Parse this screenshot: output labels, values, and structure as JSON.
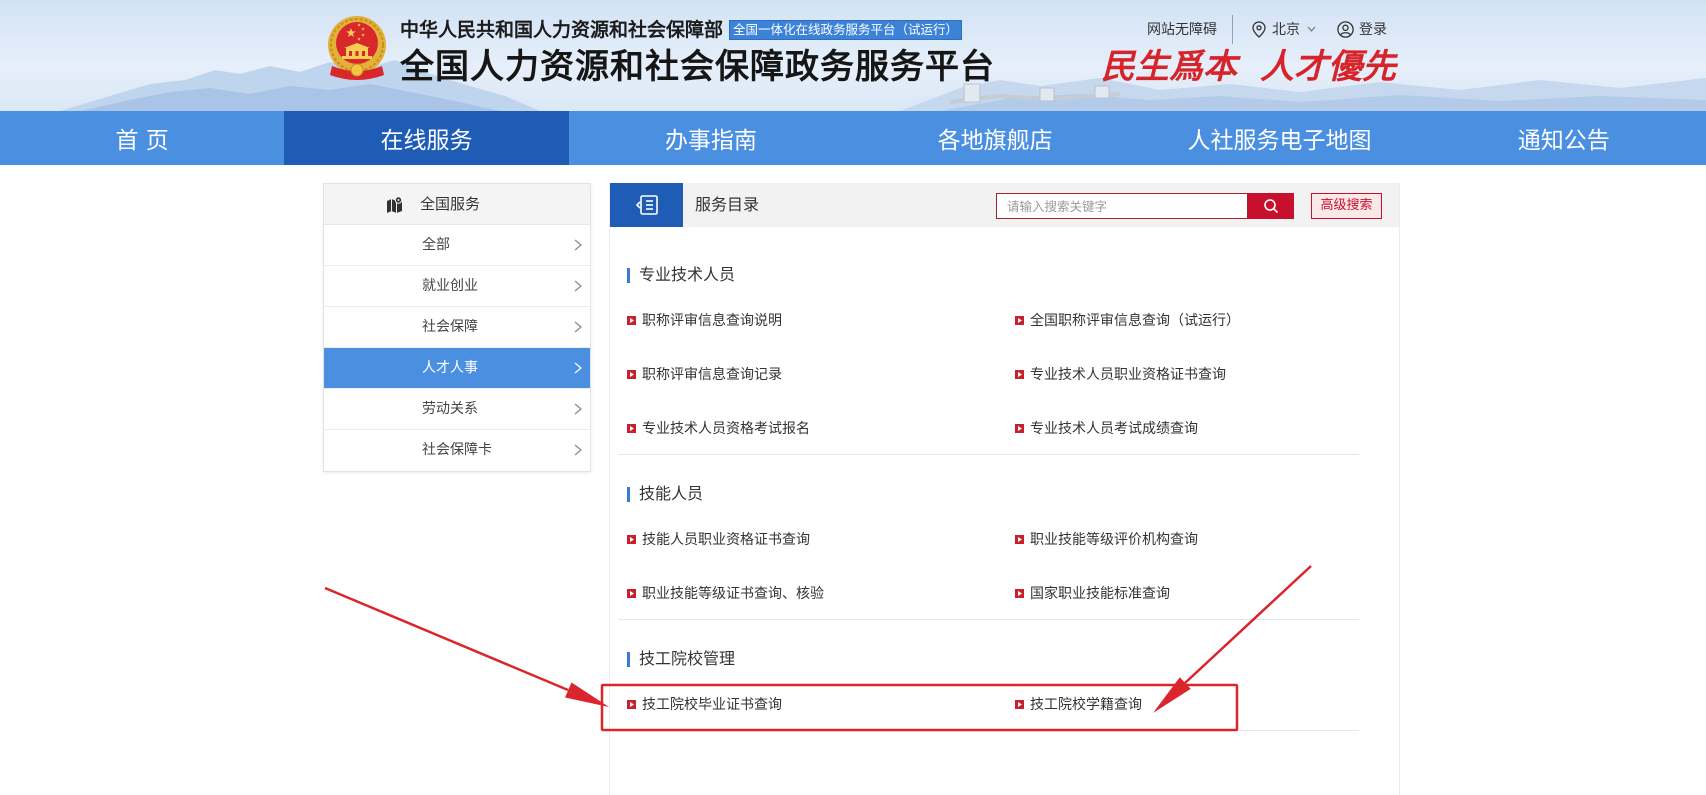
{
  "header": {
    "ministry": "中华人民共和国人力资源和社会保障部",
    "platform_badge": "全国一体化在线政务服务平台（试运行）",
    "title": "全国人力资源和社会保障政务服务平台",
    "slogan": [
      "民生爲本",
      "人才優先"
    ],
    "accessibility_link": "网站无障碍",
    "location": "北京",
    "login": "登录",
    "emblem_icon": "national-emblem-icon",
    "location_icon": "map-pin-icon",
    "dropdown_icon": "chevron-down-icon",
    "user_icon": "user-circle-icon"
  },
  "nav": {
    "items": [
      {
        "label": "首 页",
        "active": false
      },
      {
        "label": "在线服务",
        "active": true
      },
      {
        "label": "办事指南",
        "active": false
      },
      {
        "label": "各地旗舰店",
        "active": false
      },
      {
        "label": "人社服务电子地图",
        "active": false
      },
      {
        "label": "通知公告",
        "active": false
      }
    ]
  },
  "sidebar": {
    "title": "全国服务",
    "title_icon": "map-icon",
    "item_icon": "chevron-right-icon",
    "items": [
      {
        "label": "全部",
        "active": false
      },
      {
        "label": "就业创业",
        "active": false
      },
      {
        "label": "社会保障",
        "active": false
      },
      {
        "label": "人才人事",
        "active": true
      },
      {
        "label": "劳动关系",
        "active": false
      },
      {
        "label": "社会保障卡",
        "active": false
      }
    ]
  },
  "catalog": {
    "title": "服务目录",
    "title_icon": "catalog-icon",
    "search": {
      "placeholder": "请输入搜索关键字",
      "value": ""
    },
    "search_icon": "search-icon",
    "advanced_search": "高级搜索",
    "item_icon": "red-bullet-icon",
    "sections": [
      {
        "title": "专业技术人员",
        "items": [
          {
            "label": "职称评审信息查询说明",
            "highlighted": false
          },
          {
            "label": "全国职称评审信息查询（试运行）",
            "highlighted": false
          },
          {
            "label": "职称评审信息查询记录",
            "highlighted": false
          },
          {
            "label": "专业技术人员职业资格证书查询",
            "highlighted": false
          },
          {
            "label": "专业技术人员资格考试报名",
            "highlighted": false
          },
          {
            "label": "专业技术人员考试成绩查询",
            "highlighted": false
          }
        ]
      },
      {
        "title": "技能人员",
        "items": [
          {
            "label": "技能人员职业资格证书查询",
            "highlighted": false
          },
          {
            "label": "职业技能等级评价机构查询",
            "highlighted": false
          },
          {
            "label": "职业技能等级证书查询、核验",
            "highlighted": false
          },
          {
            "label": "国家职业技能标准查询",
            "highlighted": false
          }
        ]
      },
      {
        "title": "技工院校管理",
        "items": [
          {
            "label": "技工院校毕业证书查询",
            "highlighted": true
          },
          {
            "label": "技工院校学籍查询",
            "highlighted": true
          }
        ]
      }
    ]
  },
  "annotations": {
    "color": "#d9252b",
    "arrow_count": 2
  },
  "theme": {
    "nav_blue": "#4b8fe1",
    "active_blue": "#1e5cb6",
    "accent_red": "#c8102e",
    "slogan_red": "#d7242b"
  }
}
